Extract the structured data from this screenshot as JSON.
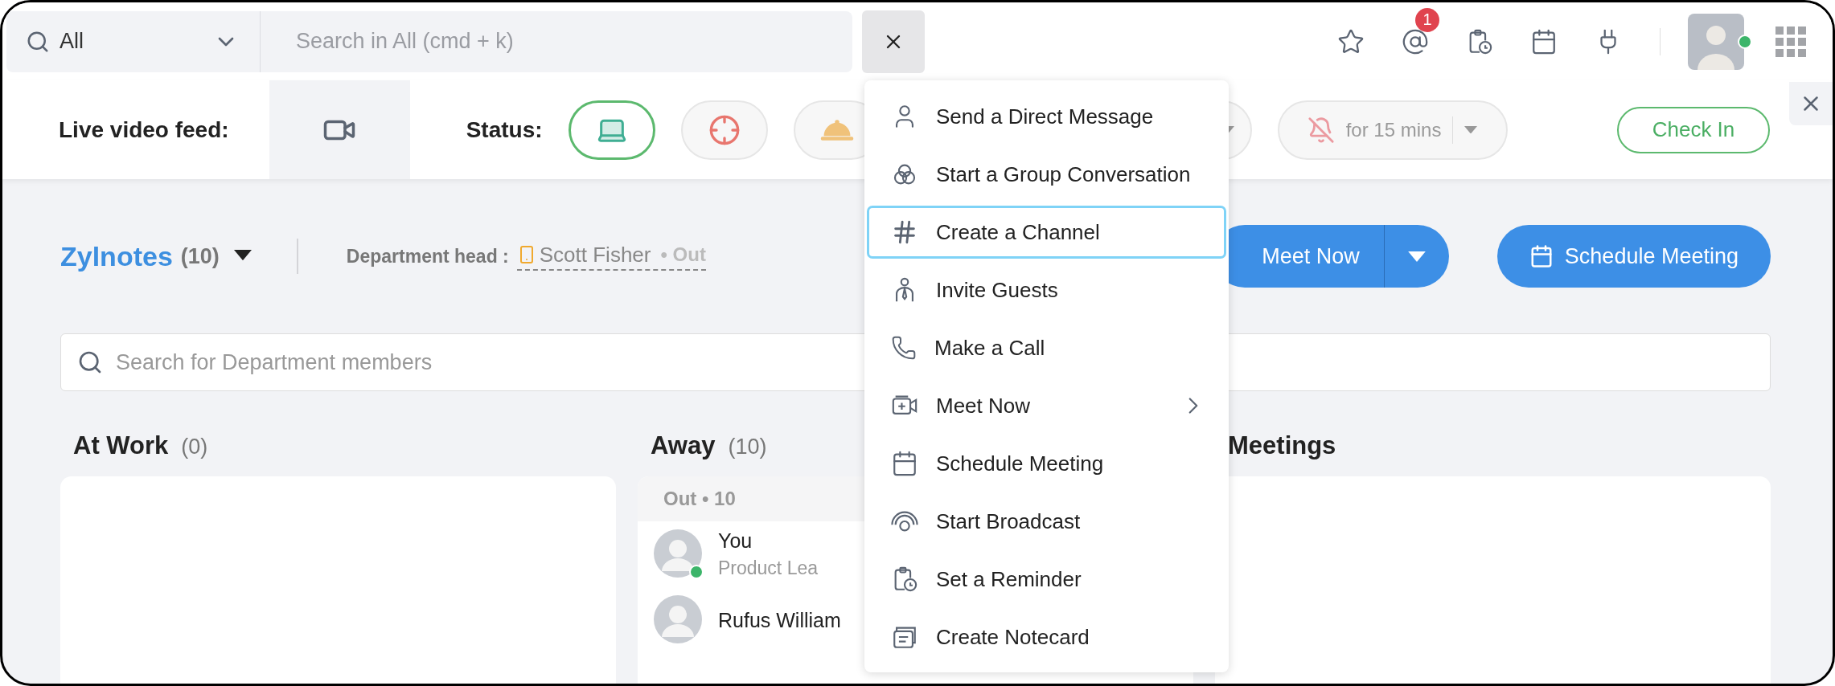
{
  "search": {
    "scope": "All",
    "placeholder": "Search in All (cmd + k)"
  },
  "toolbar": {
    "mentions_badge": "1"
  },
  "live_video": {
    "label": "Live video feed:"
  },
  "status": {
    "label": "Status:",
    "options": [
      {
        "kind": "laptop",
        "selected": true
      },
      {
        "kind": "target",
        "selected": false
      },
      {
        "kind": "meal",
        "selected": false
      }
    ]
  },
  "mute": {
    "label": "for 15 mins"
  },
  "check_in": "Check In",
  "department": {
    "name": "Zylnotes",
    "count": "(10)",
    "head_label": "Department head :",
    "head_name": "Scott Fisher",
    "head_status": "• Out"
  },
  "actions": [
    {
      "kind": "split",
      "label": "Meet Now"
    },
    {
      "kind": "calendar",
      "label": "Schedule Meeting"
    }
  ],
  "member_search": {
    "placeholder": "Search for Department members"
  },
  "columns": [
    {
      "title": "At Work",
      "count": "(0)"
    },
    {
      "title": "Away",
      "count": "(10)",
      "group": "Out • 10",
      "members": [
        {
          "name": "You",
          "role": "Product Lea",
          "online": true
        },
        {
          "name": "Rufus William"
        }
      ]
    },
    {
      "title": "Meetings"
    }
  ],
  "menu": {
    "items": [
      {
        "kind": "person",
        "label": "Send a Direct Message",
        "selected": false,
        "submenu": false
      },
      {
        "kind": "group",
        "label": "Start a Group Conversation",
        "selected": false,
        "submenu": false
      },
      {
        "kind": "hash",
        "label": "Create a Channel",
        "selected": true,
        "submenu": false
      },
      {
        "kind": "guest",
        "label": "Invite Guests",
        "selected": false,
        "submenu": false
      },
      {
        "kind": "phone",
        "label": "Make a Call",
        "selected": false,
        "submenu": false
      },
      {
        "kind": "video",
        "label": "Meet Now",
        "selected": false,
        "submenu": true
      },
      {
        "kind": "calendar",
        "label": "Schedule Meeting",
        "selected": false,
        "submenu": false
      },
      {
        "kind": "broadcast",
        "label": "Start Broadcast",
        "selected": false,
        "submenu": false
      },
      {
        "kind": "reminder",
        "label": "Set a Reminder",
        "selected": false,
        "submenu": false
      },
      {
        "kind": "notecard",
        "label": "Create Notecard",
        "selected": false,
        "submenu": false
      }
    ]
  }
}
